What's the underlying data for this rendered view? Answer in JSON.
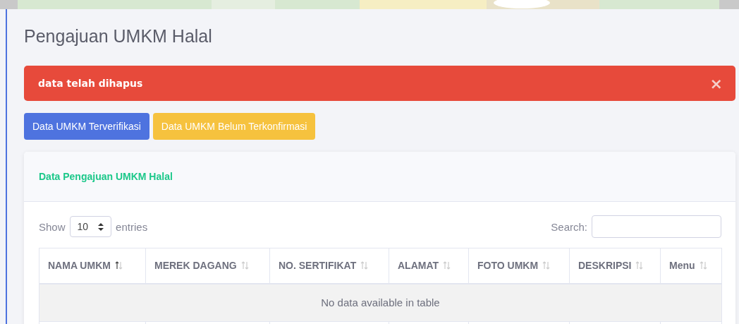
{
  "page_title": "Pengajuan UMKM Halal",
  "alert": {
    "message": "data telah dihapus",
    "close": "×"
  },
  "buttons": [
    {
      "label": "Data UMKM Terverifikasi",
      "kind": "primary"
    },
    {
      "label": "Data UMKM Belum Terkonfirmasi",
      "kind": "warning"
    }
  ],
  "card": {
    "title": "Data Pengajuan UMKM Halal",
    "length": {
      "show": "Show",
      "value": "10",
      "entries": "entries"
    },
    "search": {
      "label": "Search:"
    },
    "table": {
      "columns": [
        {
          "label": "NAMA UMKM",
          "sorted": true
        },
        {
          "label": "MEREK DAGANG",
          "sorted": false
        },
        {
          "label": "NO. SERTIFIKAT",
          "sorted": false
        },
        {
          "label": "ALAMAT",
          "sorted": false
        },
        {
          "label": "FOTO UMKM",
          "sorted": false
        },
        {
          "label": "DESKRIPSI",
          "sorted": false
        },
        {
          "label": "Menu",
          "sorted": false
        }
      ],
      "empty_message": "No data available in table"
    }
  }
}
